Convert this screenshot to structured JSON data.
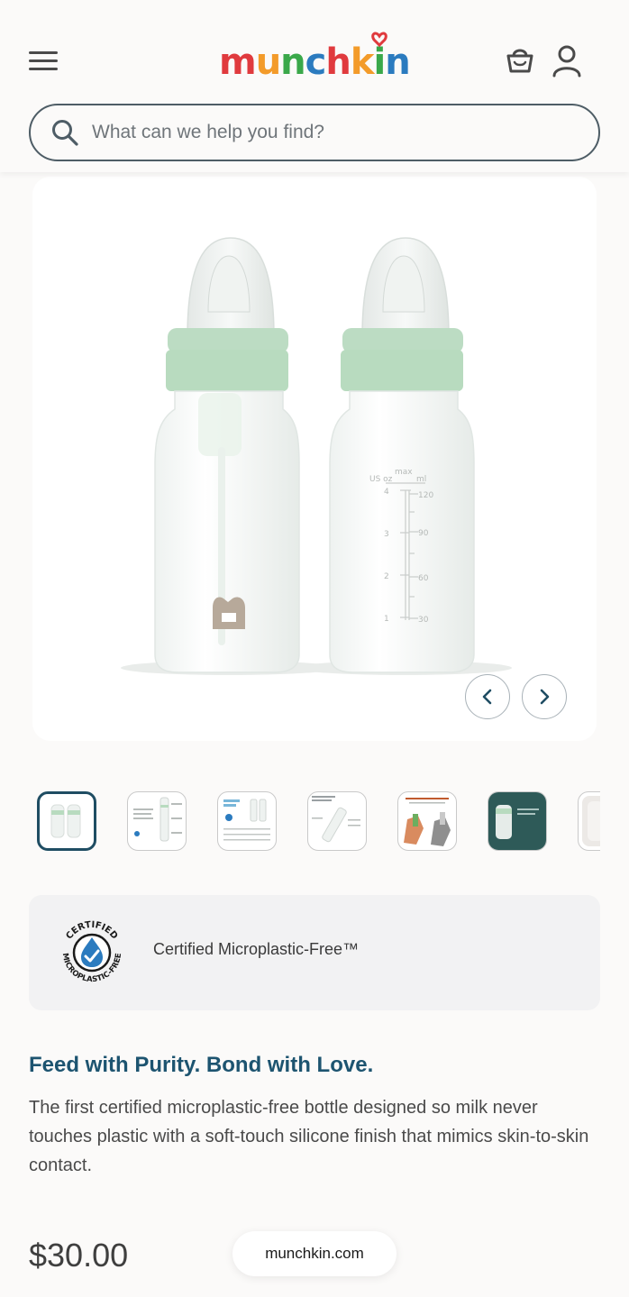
{
  "header": {
    "brand": "munchkin",
    "search": {
      "placeholder": "What can we help you find?"
    }
  },
  "product": {
    "image_alt": "Two microplastic-free glass baby bottles with green collars",
    "thumbnails_count": 7,
    "active_thumbnail": 1,
    "certification": {
      "badge_top_text": "CERTIFIED",
      "badge_bottom_text": "MICROPLASTIC-FREE",
      "label": "Certified Microplastic-Free™"
    },
    "tagline": "Feed with Purity. Bond with Love.",
    "description": "The first certified microplastic-free bottle designed so milk never touches plastic with a soft-touch silicone finish that mimics skin-to-skin contact.",
    "price": "$30.00",
    "bottle_scale": {
      "oz_label": "US oz",
      "max_label": "max",
      "ml_label": "ml",
      "oz_ticks": [
        "4",
        "3",
        "2",
        "1"
      ],
      "ml_ticks": [
        "120",
        "90",
        "60",
        "30"
      ]
    }
  },
  "browser": {
    "url": "munchkin.com"
  },
  "colors": {
    "accent": "#1d5470",
    "bottle_collar": "#b9dcc1",
    "logo_red": "#e03a3e",
    "logo_orange": "#f39b2a",
    "logo_green": "#3aa84a",
    "logo_blue": "#2b7bbf"
  }
}
